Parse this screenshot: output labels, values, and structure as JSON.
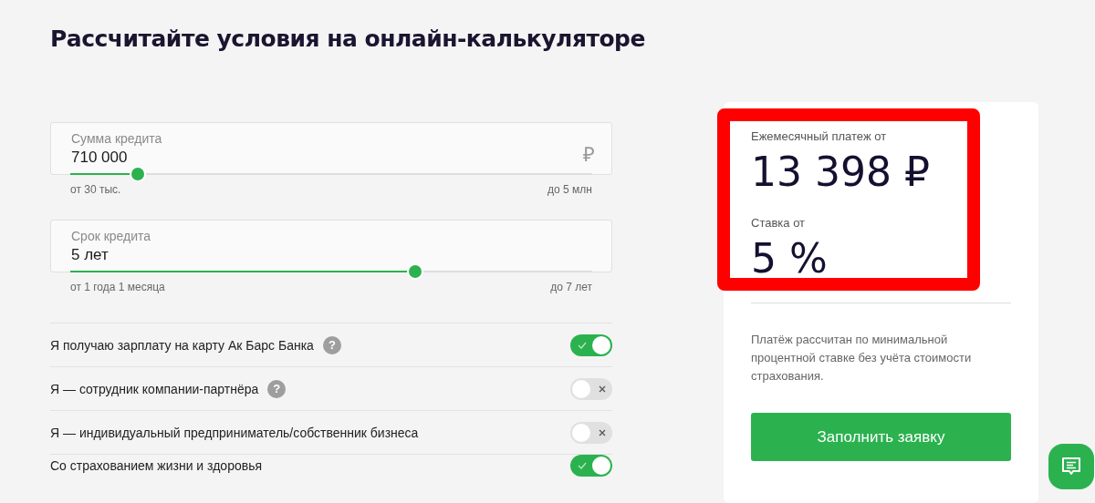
{
  "title": "Рассчитайте условия на онлайн-калькуляторе",
  "sliders": [
    {
      "label": "Сумма кредита",
      "value": "710 000",
      "unit": "₽",
      "level": 0.13,
      "min": "от 30 тыс.",
      "max": "до 5 млн"
    },
    {
      "label": "Срок кредита",
      "value": "5 лет",
      "level": 0.66,
      "min": "от 1 года 1 месяца",
      "max": "до 7 лет"
    }
  ],
  "options": [
    {
      "label": "Я получаю зарплату на карту Ак Барс Банка",
      "help": "?",
      "on": true
    },
    {
      "label": "Я — сотрудник компании-партнёра",
      "help": "?",
      "on": false
    },
    {
      "label": "Я — индивидуальный предприниматель/собственник бизнеса",
      "on": false
    },
    {
      "label": "Со страхованием жизни и здоровья",
      "on": true
    }
  ],
  "result": {
    "payment_label": "Ежемесячный платеж от",
    "payment": "13 398 ₽",
    "rate_label": "Ставка от",
    "rate": "5 %",
    "note": "Платёж рассчитан по минимальной процентной ставке без учёта стоимости страхования.",
    "button": "Заполнить заявку"
  }
}
